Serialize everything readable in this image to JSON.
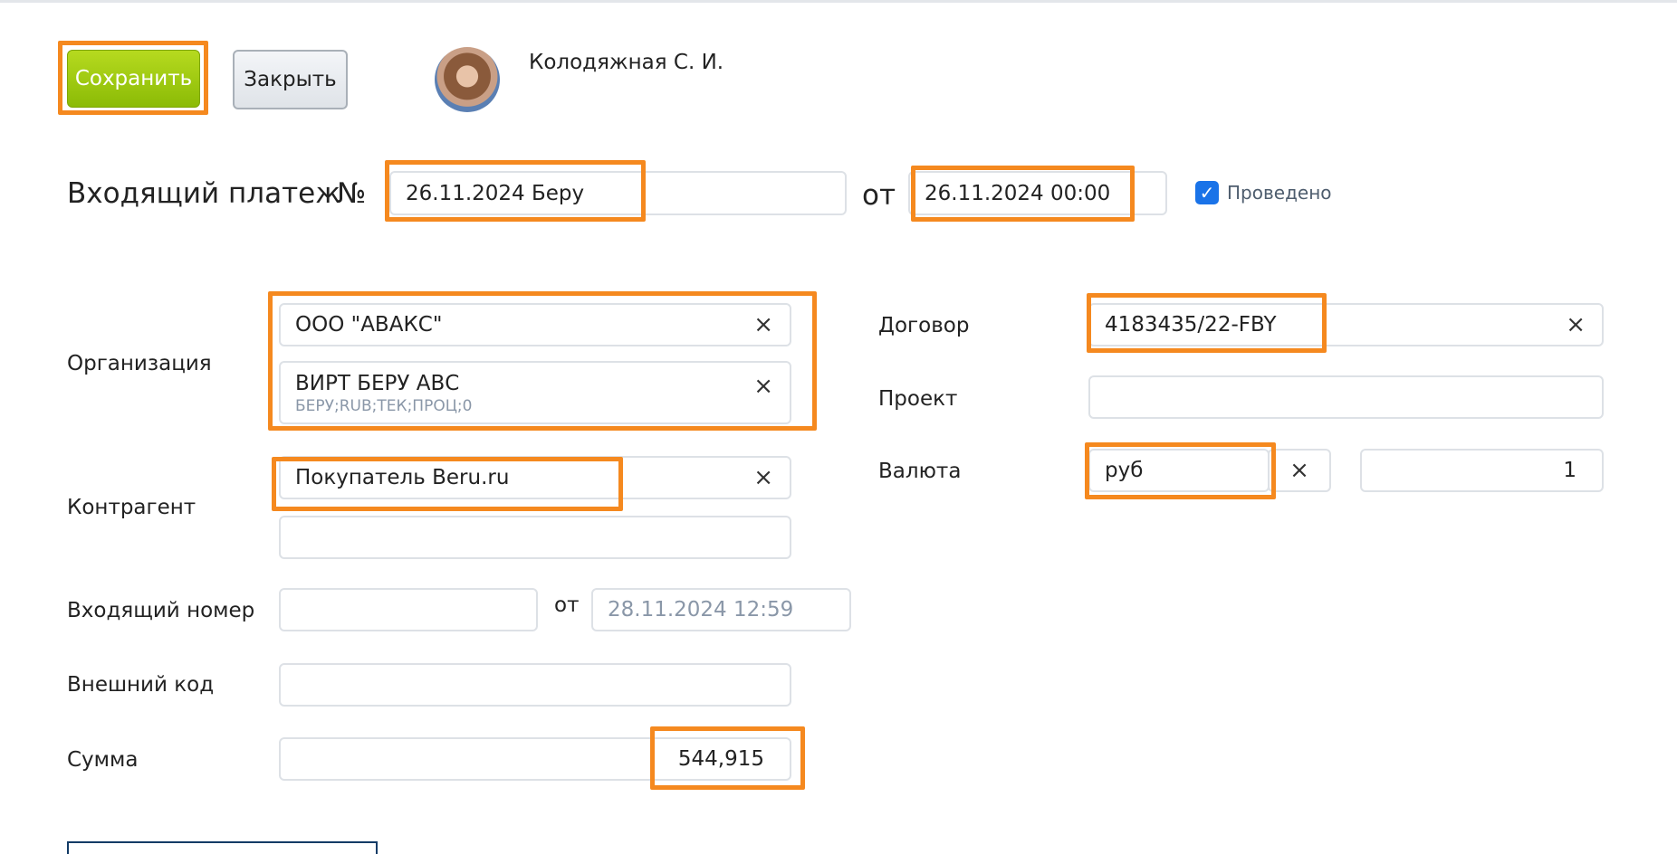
{
  "toolbar": {
    "save_label": "Сохранить",
    "close_label": "Закрыть"
  },
  "user": {
    "name": "Колодяжная С. И."
  },
  "document": {
    "title": "Входящий платеж",
    "number_sign": "№",
    "number_value": "26.11.2024 Беру",
    "date_label": "от",
    "date_value": "26.11.2024 00:00",
    "posted_label": "Проведено",
    "posted_checked": true
  },
  "fields": {
    "organization_label": "Организация",
    "organization_value": "ООО \"АВАКС\"",
    "account_value": "ВИРТ БЕРУ АВС",
    "account_sub": "БЕРУ;RUB;ТЕК;ПРОЦ;0",
    "counterparty_label": "Контрагент",
    "counterparty_value": "Покупатель Beru.ru",
    "counterparty_extra_value": "",
    "incoming_number_label": "Входящий номер",
    "incoming_number_value": "",
    "incoming_date_label": "от",
    "incoming_date_placeholder": "28.11.2024 12:59",
    "external_code_label": "Внешний код",
    "external_code_value": "",
    "amount_label": "Сумма",
    "amount_value": "544,915",
    "contract_label": "Договор",
    "contract_value": "4183435/22-FBY",
    "project_label": "Проект",
    "project_value": "",
    "currency_label": "Валюта",
    "currency_value": "руб",
    "rate_value": "1"
  },
  "icons": {
    "clear": "×",
    "check": "✓"
  },
  "colors": {
    "highlight": "#f5891f",
    "save_button": "#9cc913",
    "checkbox": "#1a73e8"
  }
}
